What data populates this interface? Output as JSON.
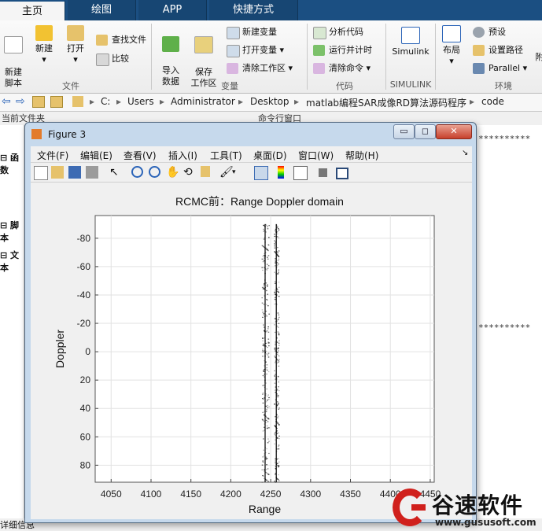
{
  "ribbon": {
    "tabs": [
      "主页",
      "绘图",
      "APP",
      "快捷方式"
    ],
    "file_group": {
      "new_script": "新建\n脚本",
      "new": "新建",
      "open": "打开",
      "find_files": "查找文件",
      "compare": "比较",
      "label": "文件"
    },
    "var_group": {
      "import": "导入\n数据",
      "save_ws": "保存\n工作区",
      "new_var": "新建变量",
      "open_var": "打开变量",
      "clear_ws": "清除工作区",
      "label": "变量"
    },
    "code_group": {
      "analyze": "分析代码",
      "run_time": "运行并计时",
      "clear_cmd": "清除命令",
      "label": "代码"
    },
    "simulink_group": {
      "button": "Simulink",
      "label": "SIMULINK"
    },
    "env_group": {
      "layout": "布局",
      "prefs": "预设",
      "set_path": "设置路径",
      "parallel": "Parallel",
      "label": "环境",
      "cut_letter": "附"
    }
  },
  "address": {
    "crumbs": [
      "C:",
      "Users",
      "Administrator",
      "Desktop",
      "matlab编程SAR成像RD算法源码程序",
      "code"
    ]
  },
  "panes": {
    "current_folder": "当前文件夹",
    "command_window": "命令行窗口",
    "left_items": [
      "函数",
      "脚本",
      "文本"
    ],
    "details": "详细信息",
    "stars_1": "**********",
    "stars_2": "**********"
  },
  "figure": {
    "title": "Figure 3",
    "menus": [
      "文件(F)",
      "编辑(E)",
      "查看(V)",
      "插入(I)",
      "工具(T)",
      "桌面(D)",
      "窗口(W)",
      "帮助(H)"
    ],
    "win_buttons": {
      "min": "▭",
      "max": "◻",
      "close": "✕"
    }
  },
  "chart_data": {
    "type": "scatter",
    "title": "RCMC前：Range Doppler domain",
    "xlabel": "Range",
    "ylabel": "Doppler",
    "xlim": [
      4030,
      4455
    ],
    "ylim": [
      -96,
      92
    ],
    "y_reversed": true,
    "grid": true,
    "xticks": [
      4050,
      4100,
      4150,
      4200,
      4250,
      4300,
      4350,
      4400,
      4450
    ],
    "yticks": [
      -80,
      -60,
      -40,
      -20,
      0,
      20,
      40,
      60,
      80
    ],
    "xtick_labels": [
      "4050",
      "4100",
      "4150",
      "4200",
      "4250",
      "4300",
      "4350",
      "4400",
      "4450"
    ],
    "ytick_labels": [
      "-80",
      "-60",
      "-40",
      "-20",
      "0",
      "20",
      "40",
      "60",
      "80"
    ],
    "series": [
      {
        "x_center": 4243,
        "y_range": [
          -90,
          92
        ],
        "color": "#000000"
      },
      {
        "x_center": 4257,
        "y_range": [
          -90,
          92
        ],
        "color": "#000000"
      }
    ]
  },
  "watermark": {
    "brand": "谷速软件",
    "url": "www.gususoft.com"
  }
}
